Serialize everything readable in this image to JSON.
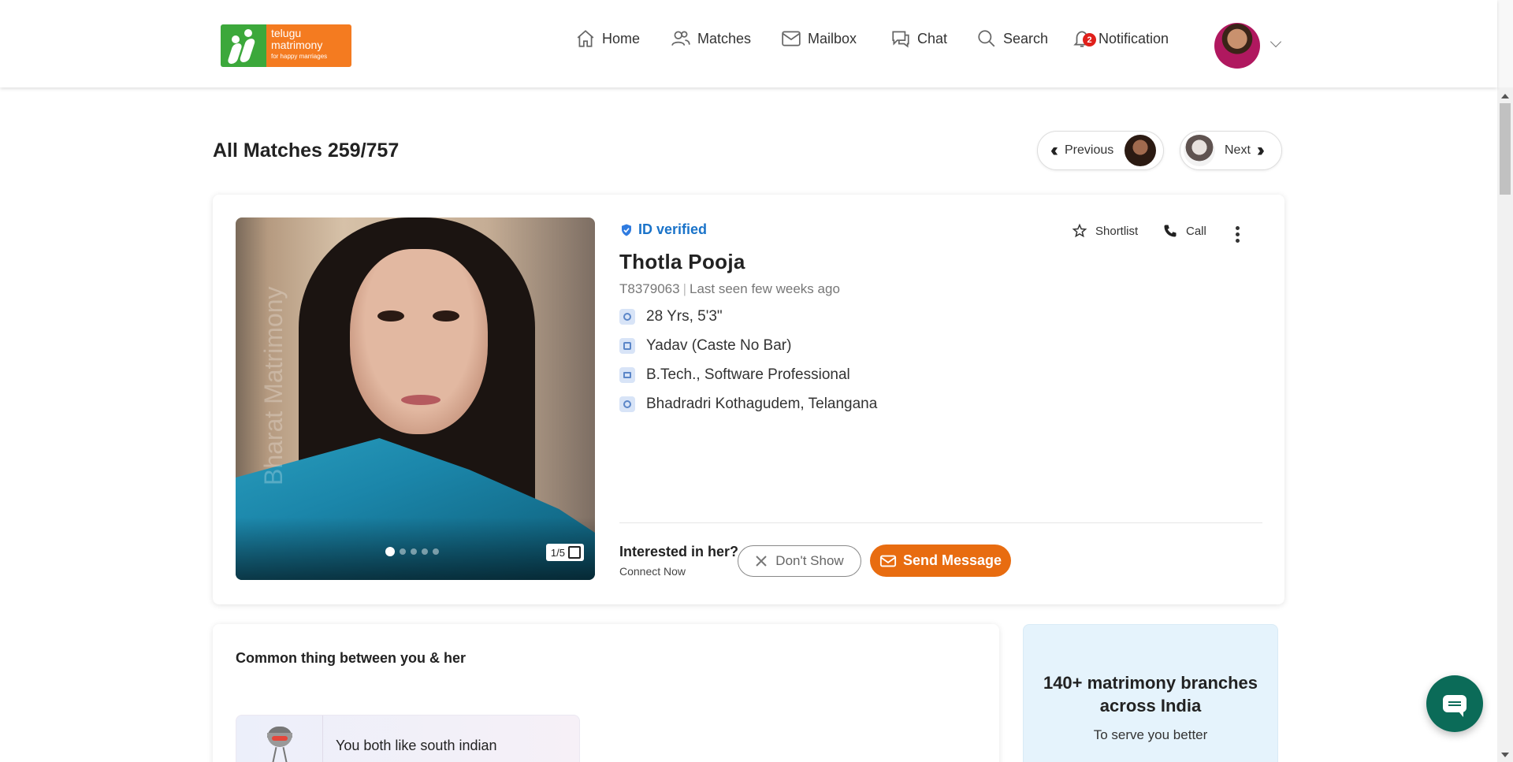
{
  "brand": {
    "line1": "telugu",
    "line2": "matrimony",
    "tagline": "for happy marriages",
    "green": "#3ca83b",
    "orange": "#f47b20"
  },
  "nav": {
    "home": "Home",
    "matches": "Matches",
    "mailbox": "Mailbox",
    "chat": "Chat",
    "search": "Search",
    "notification": "Notification",
    "notification_count": "2"
  },
  "matches_header": {
    "title": "All Matches 259/757",
    "previous": "Previous",
    "next": "Next"
  },
  "profile": {
    "verified": "ID verified",
    "name": "Thotla Pooja",
    "id": "T8379063",
    "last_seen": "Last seen few weeks ago",
    "age_height": "28 Yrs, 5'3\"",
    "caste": "Yadav (Caste No Bar)",
    "education": "B.Tech., Software Professional",
    "location": "Bhadradri Kothagudem, Telangana",
    "photo_count": "1/5",
    "photo_watermark": "Bharat Matrimony",
    "shortlist": "Shortlist",
    "call": "Call"
  },
  "interest": {
    "question": "Interested in her?",
    "sub": "Connect Now",
    "dont_show": "Don't Show",
    "send_message": "Send Message",
    "accent": "#e86c10"
  },
  "common": {
    "title": "Common thing between you & her",
    "item": "You both like south indian"
  },
  "branches": {
    "title": "140+ matrimony branches across India",
    "sub": "To serve you better"
  }
}
